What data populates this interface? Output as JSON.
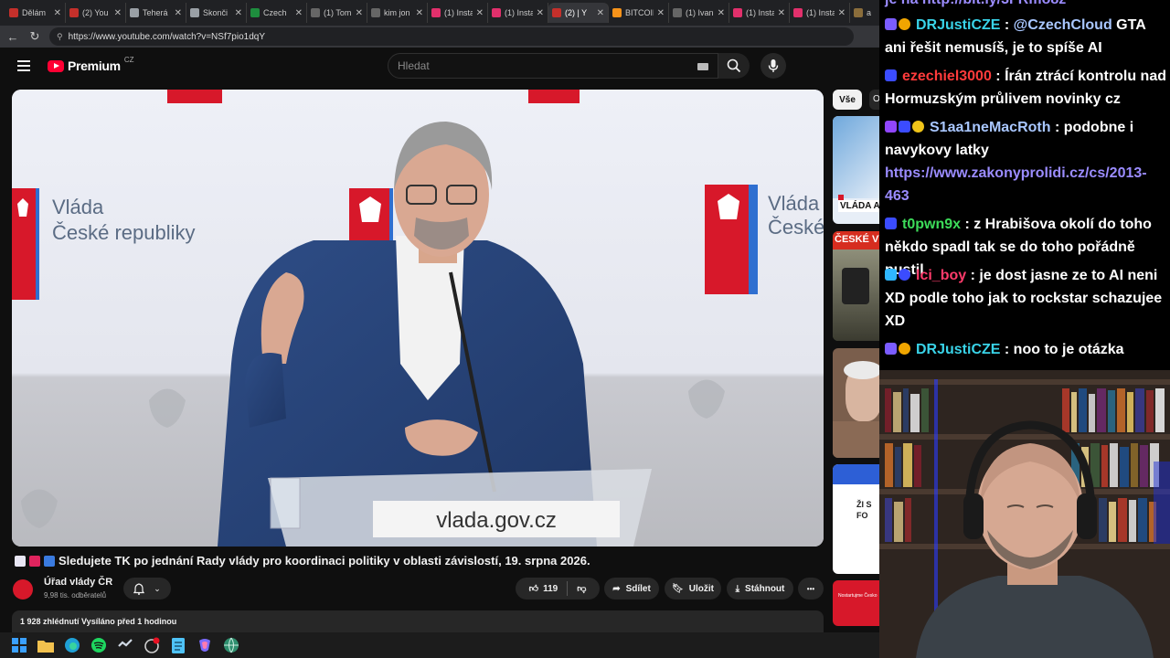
{
  "browser": {
    "tabs": [
      {
        "label": "Dělám",
        "color": "#c4302b"
      },
      {
        "label": "(2) You",
        "color": "#c4302b"
      },
      {
        "label": "Teherá",
        "color": "#9aa0a6"
      },
      {
        "label": "Skonči",
        "color": "#9aa0a6"
      },
      {
        "label": "Czech",
        "color": "#1e8e3e"
      },
      {
        "label": "(1) Tom",
        "color": "#666666"
      },
      {
        "label": "kim jon",
        "color": "#666666"
      },
      {
        "label": "(1) Insta",
        "color": "#e1306c"
      },
      {
        "label": "(1) Insta",
        "color": "#e1306c"
      },
      {
        "label": "(2) | Y",
        "color": "#c4302b",
        "active": true
      },
      {
        "label": "BITCOIN",
        "color": "#f7931a"
      },
      {
        "label": "(1) Ivan",
        "color": "#666666"
      },
      {
        "label": "(1) Insta",
        "color": "#e1306c"
      },
      {
        "label": "(1) Insta",
        "color": "#e1306c"
      },
      {
        "label": "a",
        "color": "#8a6d3b"
      }
    ],
    "tab_close": "✕",
    "url": "https://www.youtube.com/watch?v=NSf7pio1dqY"
  },
  "youtube": {
    "logo_text": "Premium",
    "logo_region": "CZ",
    "search_placeholder": "Hledat",
    "video": {
      "sign_line1": "Vláda",
      "sign_line2": "České republiky",
      "podium_text": "vlada.gov.cz"
    },
    "title": "Sledujete TK po jednání Rady vlády pro koordinaci politiky v oblasti závislostí, 19. srpna 2026.",
    "channel_name": "Úřad vlády ČR",
    "subscribers": "9,98 tis. odběratelů",
    "likes": "119",
    "share_label": "Sdílet",
    "save_label": "Uložit",
    "download_label": "Stáhnout",
    "more_label": "•••",
    "views_line": "1 928 zhlédnutí  Vysíláno před 1 hodinou",
    "chips": [
      "Vše",
      "O"
    ],
    "rec_thumb_texts": [
      "VLÁDA A",
      "ČESKÉ VY",
      "ŽI S FO",
      "Nostartujme Česko"
    ]
  },
  "chat": {
    "top_partial": "je na http://bit.ly/3FRmo8z",
    "messages": [
      {
        "user": "DRJustiCZE",
        "user_color": "#39d3e8",
        "text": "@CzechCloud GTA ani řešit nemusíš, je to spíše AI",
        "mention": "@CzechCloud",
        "badges": [
          "#7b5cff",
          "#f0a500"
        ]
      },
      {
        "user": "ezechiel3000",
        "user_color": "#ff3b3b",
        "text": "Írán ztrácí kontrolu nad Hormuzským průlivem novinky cz",
        "badges": [
          "#3b4cff"
        ]
      },
      {
        "user": "S1aa1neMacRoth",
        "user_color": "#a9c7ff",
        "text": "podobne i navykovy latky",
        "link": "https://www.zakonyprolidi.cz/cs/2013-463",
        "badges": [
          "#9146ff",
          "#3b4cff",
          "#f0c419"
        ]
      },
      {
        "user": "t0pwn9x",
        "user_color": "#3ddc5a",
        "text": "z Hrabišova okolí do toho někdo spadl tak se do toho pořádně pustil",
        "badges": [
          "#3b4cff"
        ]
      },
      {
        "user": "lci_boy",
        "user_color": "#ff3b6b",
        "text": "je dost jasne ze to AI neni XD podle toho jak to rockstar schazujee XD",
        "badges": [
          "#2fb7ff",
          "#3b4cff"
        ]
      },
      {
        "user": "DRJustiCZE",
        "user_color": "#39d3e8",
        "text": "noo to je otázka",
        "badges": [
          "#7b5cff",
          "#f0a500"
        ]
      }
    ]
  },
  "taskbar": {
    "icons": [
      "windows-start",
      "file-explorer",
      "edge",
      "spotify",
      "steam",
      "discord",
      "notepad",
      "copilot",
      "network"
    ]
  }
}
